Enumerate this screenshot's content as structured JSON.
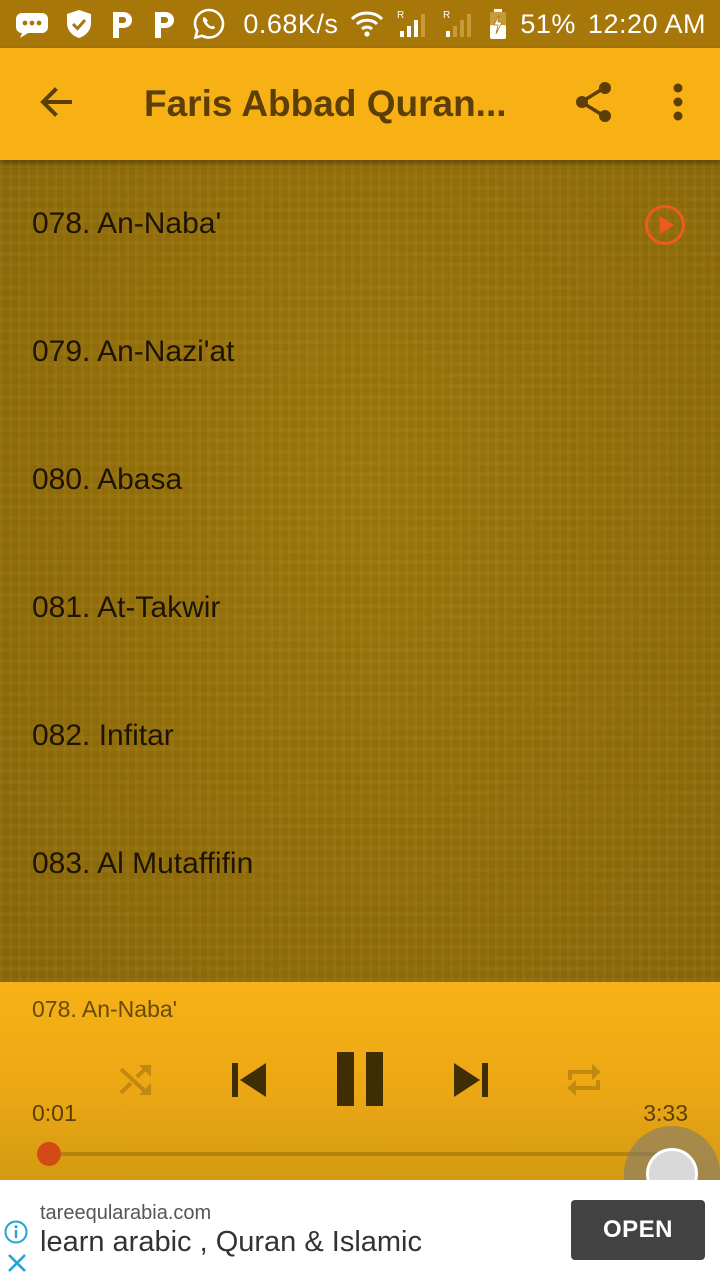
{
  "status_bar": {
    "network_speed": "0.68K/s",
    "battery": "51%",
    "time": "12:20 AM",
    "icons": [
      "messages-icon",
      "shield-check-icon",
      "p-app-icon",
      "p-app-icon",
      "whatsapp-icon",
      "wifi-icon",
      "signal-icon",
      "signal-icon",
      "battery-icon"
    ]
  },
  "app_bar": {
    "title": "Faris Abbad Quran...",
    "back_icon": "arrow-back-icon",
    "share_icon": "share-icon",
    "menu_icon": "more-vert-icon"
  },
  "tracks": [
    {
      "label": "078. An-Naba'",
      "playing": true
    },
    {
      "label": "079. An-Nazi'at",
      "playing": false
    },
    {
      "label": "080. Abasa",
      "playing": false
    },
    {
      "label": "081. At-Takwir",
      "playing": false
    },
    {
      "label": "082. Infitar",
      "playing": false
    },
    {
      "label": "083. Al Mutaffifin",
      "playing": false
    }
  ],
  "player": {
    "now_playing": "078. An-Naba'",
    "elapsed": "0:01",
    "total": "3:33",
    "progress_fraction": 0.005,
    "controls": [
      "shuffle-icon",
      "skip-previous-icon",
      "pause-icon",
      "skip-next-icon",
      "repeat-icon"
    ]
  },
  "ad": {
    "domain": "tareeqularabia.com",
    "headline": "learn arabic , Quran & Islamic",
    "cta": "OPEN"
  },
  "colors": {
    "app_bar": "#f8b115",
    "status_bar": "#a8770a",
    "list_background": "#9a7106",
    "accent_play": "#f05a1e",
    "seek_thumb": "#d24a16",
    "ad_button": "#424242"
  }
}
